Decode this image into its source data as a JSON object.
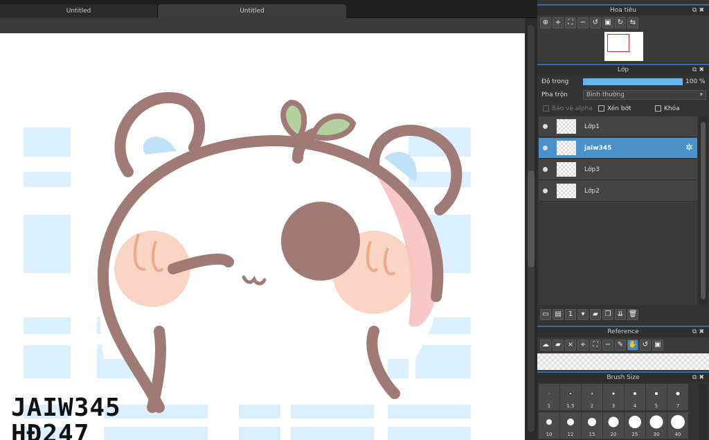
{
  "tabs": [
    {
      "label": "Untitled"
    },
    {
      "label": "Untitled"
    }
  ],
  "signature": {
    "line1": "JAIW345",
    "line2": "HĐ247"
  },
  "navigator": {
    "title": "Hoa tiêu"
  },
  "layer_panel": {
    "title": "Lớp",
    "opacity_label": "Độ trong",
    "opacity_value": "100 %",
    "opacity": 1.0,
    "blend_label": "Pha trộn",
    "blend_value": "Bình thường",
    "protect_alpha": "Bảo vệ alpha",
    "clipping": "Xén bớt",
    "lock": "Khóa",
    "layers": [
      {
        "name": "Lớp1",
        "selected": false
      },
      {
        "name": "jaiw345",
        "selected": true
      },
      {
        "name": "Lớp3",
        "selected": false
      },
      {
        "name": "Lớp2",
        "selected": false
      }
    ]
  },
  "reference": {
    "title": "Reference"
  },
  "brush_size": {
    "title": "Brush Size",
    "sizes": [
      "1",
      "1.5",
      "2",
      "3",
      "4",
      "5",
      "7",
      "10",
      "12",
      "15",
      "20",
      "25",
      "30",
      "40"
    ]
  },
  "colors": {
    "accent": "#3c8fd6",
    "selected_layer": "#4a90c9",
    "opacity_bar": "#64b5f0"
  }
}
